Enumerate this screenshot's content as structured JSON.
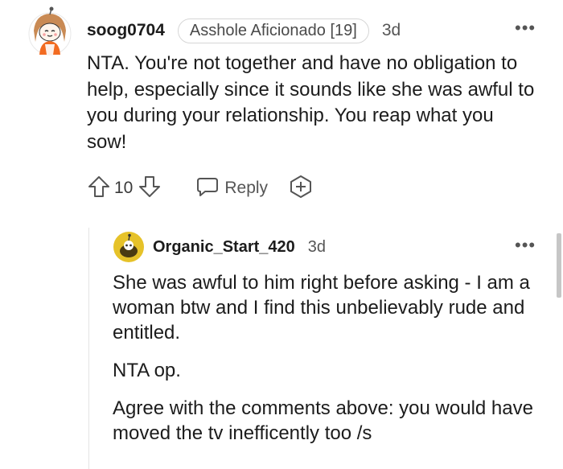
{
  "comment": {
    "username": "soog0704",
    "flair": "Asshole Aficionado [19]",
    "time": "3d",
    "more": "•••",
    "body": "NTA. You're not together and have no obligation to help, especially since it sounds like she was awful to you during your relationship. You reap what you sow!",
    "votes": "10",
    "reply_label": "Reply"
  },
  "reply": {
    "username": "Organic_Start_420",
    "time": "3d",
    "more": "•••",
    "paragraphs": [
      "She was awful to him right before asking - I am a woman btw and I find this unbelievably rude and entitled.",
      "NTA op.",
      "Agree with the comments above: you would have moved the tv inefficently too /s"
    ]
  },
  "colors": {
    "text": "#1c1c1c",
    "muted": "#555555",
    "flair_border": "#d6d6d6",
    "avatar_orange": "#f26b21",
    "avatar2_yellow": "#e6c229"
  },
  "icons": [
    "user-avatar-icon",
    "more-options-icon",
    "upvote-icon",
    "downvote-icon",
    "reply-icon",
    "award-icon"
  ]
}
